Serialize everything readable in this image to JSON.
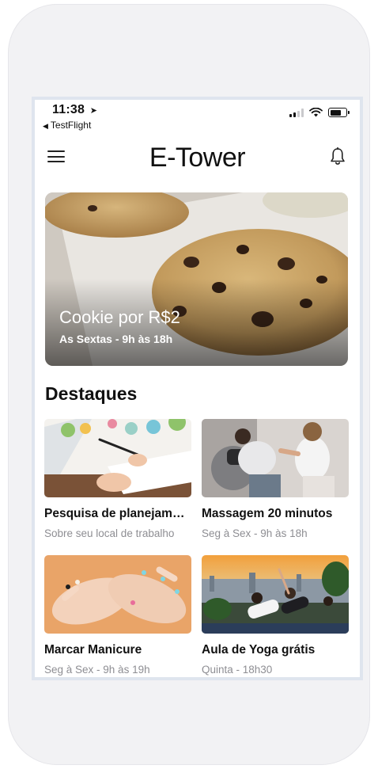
{
  "status_bar": {
    "time": "11:38",
    "location_arrow": "➤",
    "back_app": "TestFlight",
    "back_arrow": "◀"
  },
  "header": {
    "title": "E-Tower",
    "menu_icon": "hamburger-menu-icon",
    "bell_icon": "bell-icon"
  },
  "hero": {
    "title": "Cookie por R$2",
    "subtitle": "As Sextas - 9h às 18h"
  },
  "highlights": {
    "title": "Destaques",
    "items": [
      {
        "title": "Pesquisa de planejamento",
        "subtitle": "Sobre seu local de trabalho"
      },
      {
        "title": "Massagem 20 minutos",
        "subtitle": "Seg à Sex - 9h às 18h"
      },
      {
        "title": "Marcar Manicure",
        "subtitle": "Seg à Sex - 9h às 19h"
      },
      {
        "title": "Aula de Yoga grátis",
        "subtitle": "Quinta - 18h30"
      }
    ]
  },
  "colors": {
    "text": "#111111",
    "secondary_text": "#8e8e93",
    "screen_border": "#dfe5ee",
    "device_body": "#f2f2f4"
  }
}
